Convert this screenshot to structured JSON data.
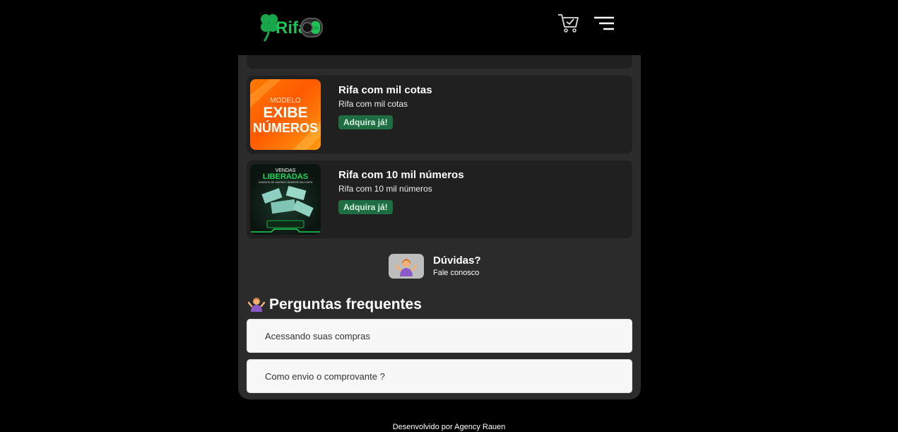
{
  "header": {
    "logo_text": "Rifa",
    "logo_badge": "ON"
  },
  "cards": [
    {
      "title": "Rifa com mil cotas",
      "subtitle": "Rifa com mil cotas",
      "button": "Adquira já!",
      "thumb_lines": [
        "MODELO",
        "EXIBE",
        "NÚMEROS"
      ]
    },
    {
      "title": "Rifa com 10 mil números",
      "subtitle": "Rifa com 10 mil números",
      "button": "Adquira já!",
      "thumb_lines": [
        "VENDAS",
        "LIBERADAS",
        "GARANTA JÁ! VALENDO DINHEIRO NA CONTA"
      ]
    }
  ],
  "help": {
    "title": "Dúvidas?",
    "subtitle": "Fale conosco"
  },
  "faq": {
    "heading": "Perguntas frequentes",
    "items": [
      "Acessando suas compras",
      "Como envio o comprovante ?"
    ]
  },
  "footer": {
    "text": "Desenvolvido por Agency Rauen"
  },
  "colors": {
    "page_bg": "#000000",
    "panel_bg": "#2b2b2b",
    "card_bg": "#202020",
    "button_bg": "#1f6e43",
    "accent_green": "#1aa64a"
  },
  "icons": [
    "clover-icon",
    "toggle-icon",
    "cart-icon",
    "menu-icon",
    "shrug-person-icon"
  ]
}
